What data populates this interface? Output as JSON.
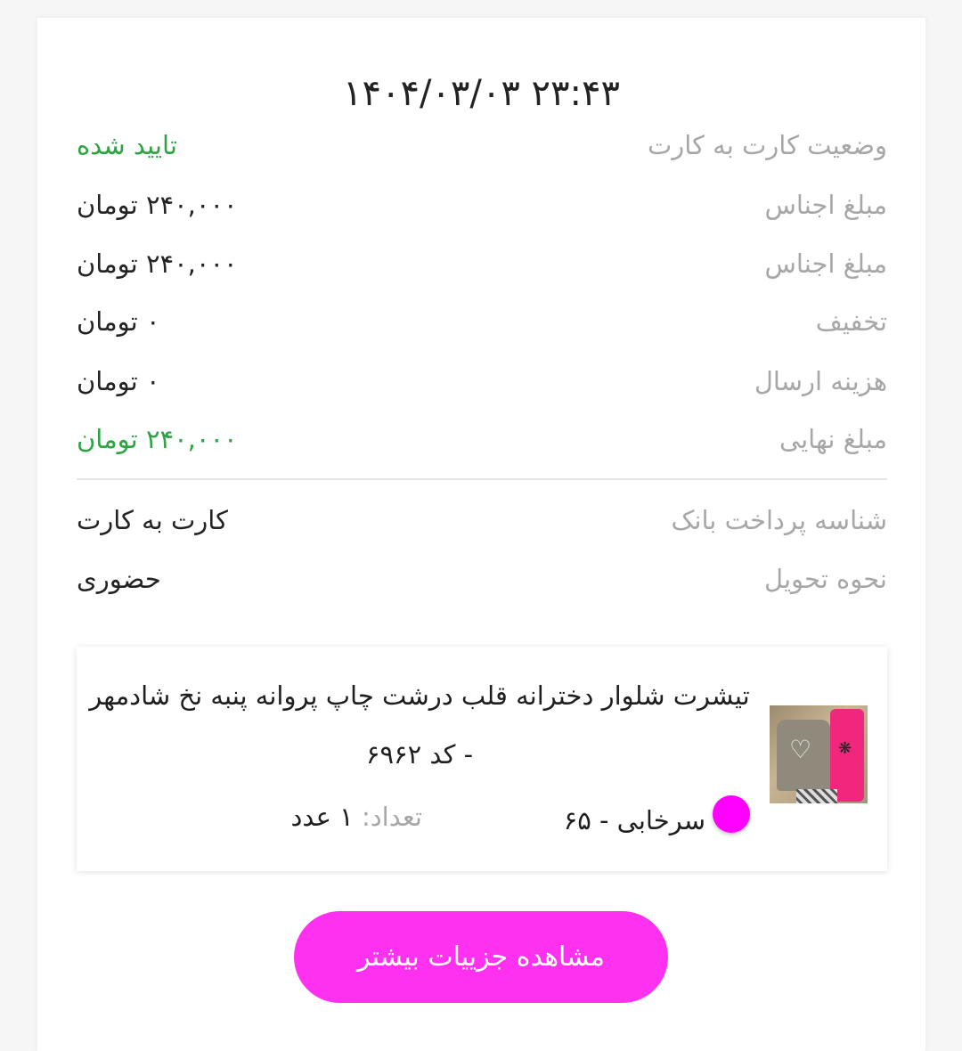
{
  "order": {
    "datetime": "۱۴۰۴/۰۳/۰۳ ۲۳:۴۳",
    "rows": [
      {
        "label": "وضعیت کارت به کارت",
        "value": "تایید شده"
      },
      {
        "label": "مبلغ اجناس",
        "value": "۲۴۰,۰۰۰ تومان"
      },
      {
        "label": "مبلغ اجناس",
        "value": "۲۴۰,۰۰۰ تومان"
      },
      {
        "label": "تخفیف",
        "value": "۰ تومان"
      },
      {
        "label": "هزینه ارسال",
        "value": "۰ تومان"
      },
      {
        "label": "مبلغ نهایی",
        "value": "۲۴۰,۰۰۰ تومان"
      }
    ],
    "payment_rows": [
      {
        "label": "شناسه پرداخت بانک",
        "value": "کارت به کارت"
      },
      {
        "label": "نحوه تحویل",
        "value": "حضوری"
      }
    ]
  },
  "product": {
    "title": "تیشرت شلوار دخترانه قلب درشت چاپ پروانه پنبه نخ شادمهر - کد ۶۹۶۲",
    "color_hex": "#ff00ff",
    "variant": "سرخابی - ۶۵",
    "qty_label": "تعداد:",
    "qty_value": "۱ عدد"
  },
  "actions": {
    "details_button": "مشاهده جزییات بیشتر"
  },
  "colors": {
    "accent": "#ff30f0",
    "success": "#2ea344",
    "label": "#a7a7a7"
  }
}
